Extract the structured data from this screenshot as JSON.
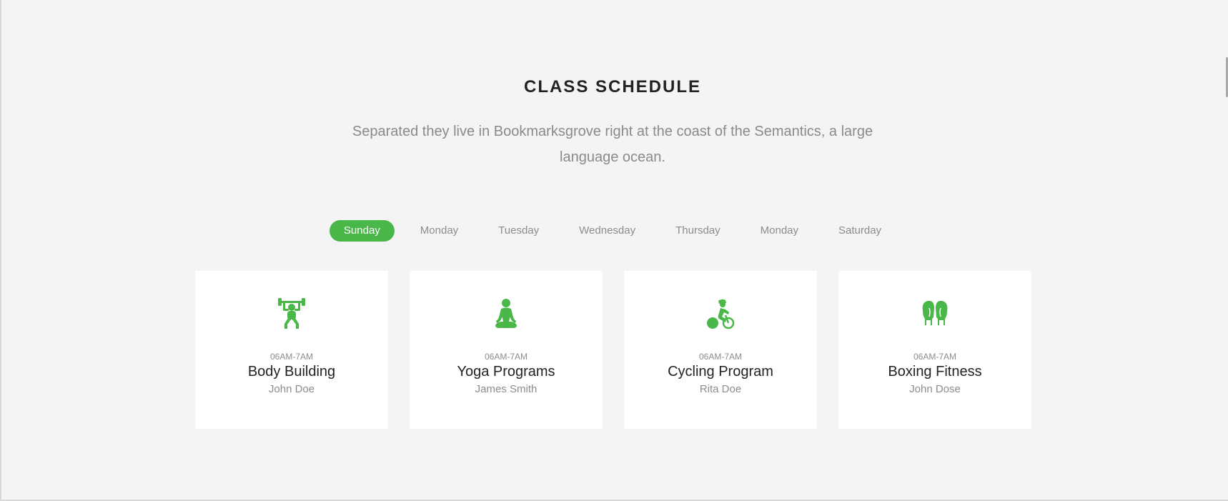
{
  "colors": {
    "accent": "#4ab749",
    "background": "#f4f4f4",
    "card": "#ffffff",
    "heading": "#222222",
    "muted": "#8c8c8c"
  },
  "section": {
    "title": "CLASS SCHEDULE",
    "subtitle": "Separated they live in Bookmarksgrove right at the coast of the Semantics, a large language ocean."
  },
  "tabs": [
    {
      "label": "Sunday",
      "active": true
    },
    {
      "label": "Monday",
      "active": false
    },
    {
      "label": "Tuesday",
      "active": false
    },
    {
      "label": "Wednesday",
      "active": false
    },
    {
      "label": "Thursday",
      "active": false
    },
    {
      "label": "Monday",
      "active": false
    },
    {
      "label": "Saturday",
      "active": false
    }
  ],
  "classes": [
    {
      "icon": "weightlifting-icon",
      "time": "06AM-7AM",
      "name": "Body Building",
      "trainer": "John Doe"
    },
    {
      "icon": "yoga-icon",
      "time": "06AM-7AM",
      "name": "Yoga Programs",
      "trainer": "James Smith"
    },
    {
      "icon": "cycling-icon",
      "time": "06AM-7AM",
      "name": "Cycling Program",
      "trainer": "Rita Doe"
    },
    {
      "icon": "boxing-gloves-icon",
      "time": "06AM-7AM",
      "name": "Boxing Fitness",
      "trainer": "John Dose"
    }
  ]
}
